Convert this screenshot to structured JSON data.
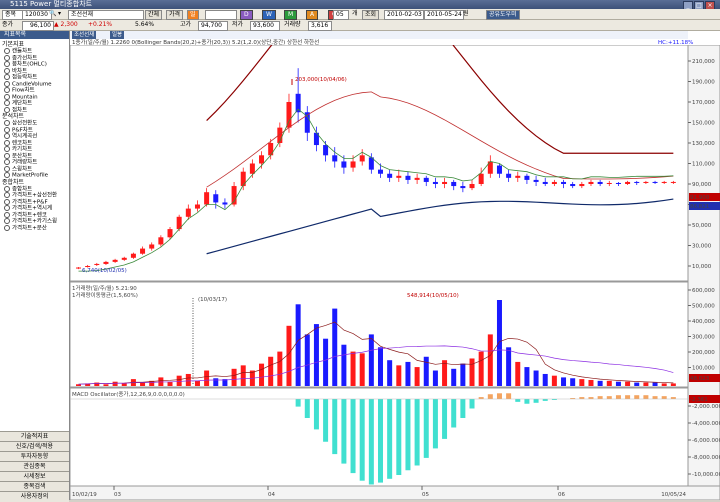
{
  "window": {
    "title": "5115 Power 멀티종합차트",
    "brand_icon": "app-logo"
  },
  "toolbar1": {
    "market": "종목",
    "code": "120030",
    "name": "조선선재",
    "buttons": [
      "간체",
      "가격",
      "일"
    ],
    "period_btns": [
      "D",
      "W",
      "M",
      "A",
      "C"
    ],
    "count": "05",
    "count_unit": "개",
    "view_btn": "조회",
    "date_from": "2010-02-03",
    "date_to": "2010-05-24",
    "unit": "원",
    "action_btn": "공유도우미"
  },
  "toolbar2": {
    "label_left": "종가",
    "price": "96,100",
    "change": "▲ 2,300",
    "rate": "+0.21%",
    "high_label": "5.64%",
    "vol1": "94,700",
    "vol1_label": "고가",
    "vol2": "93,600",
    "vol2_label": "저가",
    "vol3": "3,616",
    "vol3_label": "거래량"
  },
  "sidebar": {
    "header": "지표목록",
    "groups": [
      {
        "title": "기본지표",
        "items": [
          "캔들차트",
          "종가선차트",
          "봉차트(OHLC)",
          "바차트",
          "점등락차트",
          "CandleVolume",
          "Flow차트",
          "Mountain",
          "계단차트",
          "점차트"
        ]
      },
      {
        "title": "분석차트",
        "items": [
          "삼선전환도",
          "P&F차트",
          "역시계곡선",
          "렌코차트",
          "카기차트",
          "분산차트",
          "거래량차트",
          "스윙차트",
          "MarketProfile"
        ]
      },
      {
        "title": "종합차트",
        "items": [
          "종합차트",
          "가격차트+삼선전환",
          "가격차트+P&F",
          "가격차트+역시계",
          "가격차트+렌코",
          "가격차트+카기스윙",
          "가격차트+분산"
        ]
      }
    ],
    "bottom_buttons": [
      "기술적지표",
      "신호/검색/적용",
      "투자자동향",
      "관심종목",
      "시세정보",
      "종목검색",
      "사용자정의"
    ]
  },
  "chart_tabs": {
    "tab1": "조선선재",
    "tab2": "일봉",
    "legend": "1종가(일/주/월) 1.2260  0(Bollinger Bands(20,2)+종가(20,3)) 5.2(1,2.0)(상단,중간)  상한선 하한선",
    "top_right": "HC:+11.18%"
  },
  "price_panel": {
    "annot_high": "203,000(10/04/06)",
    "annot_low": "6,740(10/02/05)",
    "y_ticks": [
      "210,000",
      "190,000",
      "170,000",
      "150,000",
      "130,000",
      "110,000",
      "90,000",
      "70,000",
      "50,000",
      "30,000",
      "10,000"
    ],
    "last_price_badge": "91,900",
    "last_price_badge2": "86,821"
  },
  "volume_panel": {
    "legend1": "1거래량(일/주/월) 5.21:90",
    "legend2": "1거래량이동평균(1,5,60%)",
    "annot_date": "(10/03/17)",
    "annot_high": "548,914(10/05/10)",
    "y_ticks": [
      "600,000",
      "500,000",
      "400,000",
      "300,000",
      "200,000",
      "100,000"
    ],
    "last_badge": "48,023"
  },
  "macd_panel": {
    "legend": "MACD Oscillator(종가,12,26,9,0.0,0,0,0.0)",
    "y_ticks": [
      "-2,000.000",
      "-4,000.000",
      "-6,000.000",
      "-8,000.000",
      "-10,000.000"
    ],
    "last_badge": "-2,361"
  },
  "x_axis": {
    "labels": [
      "10/02/19",
      "03",
      "04",
      "05",
      "06"
    ],
    "right_label": "10/05/24"
  },
  "colors": {
    "up": "#ff1a1a",
    "down": "#1a1aff",
    "band": "#8b0000",
    "band_low": "#102a6a",
    "ma": "#3a8a3a",
    "osc_neg": "#40e0d0",
    "osc_pos": "#f4a460"
  }
}
